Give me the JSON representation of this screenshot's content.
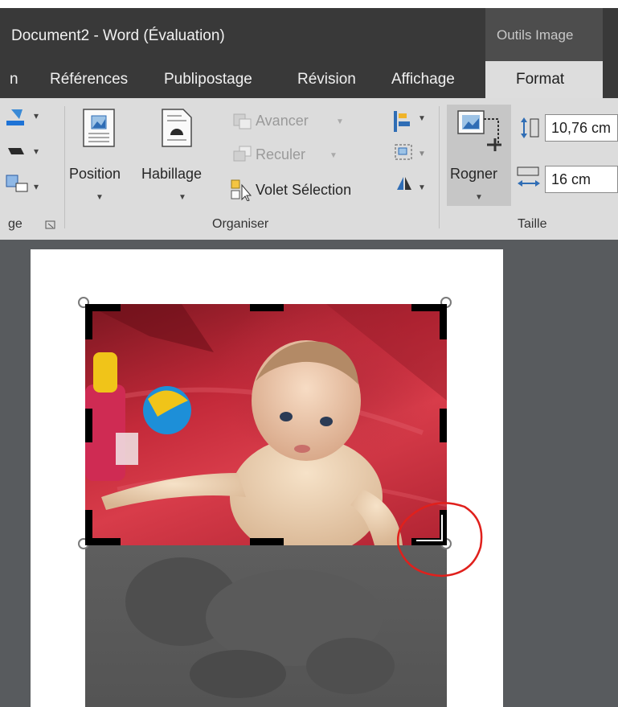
{
  "window": {
    "title": "Document2 - Word (Évaluation)",
    "contextual_group": "Outils Image"
  },
  "tabs": [
    {
      "label": "n"
    },
    {
      "label": "Références"
    },
    {
      "label": "Publipostage"
    },
    {
      "label": "Révision"
    },
    {
      "label": "Affichage"
    },
    {
      "label": "Format"
    }
  ],
  "ribbon": {
    "truncated_group_label": "ge",
    "organiser": {
      "group_label": "Organiser",
      "position": "Position",
      "habillage": "Habillage",
      "avancer": "Avancer",
      "reculer": "Reculer",
      "volet_selection": "Volet Sélection"
    },
    "taille": {
      "group_label": "Taille",
      "rogner": "Rogner",
      "height_value": "10,76 cm",
      "width_value": "16 cm"
    }
  },
  "colors": {
    "titlebar": "#393939",
    "ribbon": "#dcdcdc",
    "document_background": "#585b5e",
    "crop_annotation": "#e0201c"
  }
}
